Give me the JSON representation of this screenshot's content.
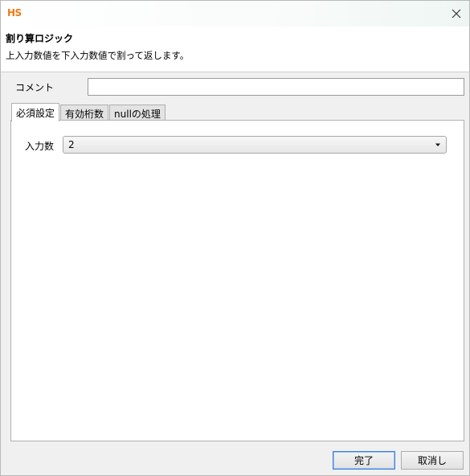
{
  "window": {
    "app_logo": "HS"
  },
  "header": {
    "title": "割り算ロジック",
    "description": "上入力数値を下入力数値で割って返します。"
  },
  "comment": {
    "label": "コメント",
    "value": ""
  },
  "tabs": [
    {
      "label": "必須設定",
      "active": true
    },
    {
      "label": "有効桁数",
      "active": false
    },
    {
      "label": "nullの処理",
      "active": false
    }
  ],
  "required_settings": {
    "input_count_label": "入力数",
    "input_count_value": "2"
  },
  "buttons": {
    "ok_label": "完了",
    "cancel_label": "取消し"
  },
  "colors": {
    "logo": "#f07a16",
    "primary_button_border": "#3c7fd6"
  },
  "icons": {
    "close": "close-icon",
    "dropdown": "chevron-down-icon"
  }
}
